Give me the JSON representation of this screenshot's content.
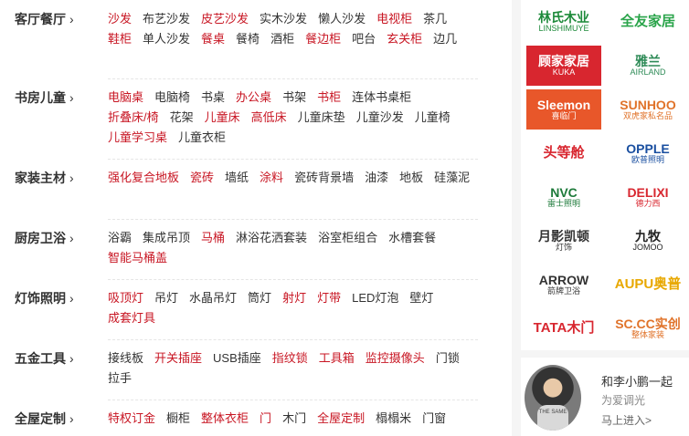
{
  "categories": [
    {
      "title": "客厅餐厅",
      "arrow": "›",
      "links": [
        {
          "text": "沙发",
          "hot": true
        },
        {
          "text": "布艺沙发",
          "hot": false
        },
        {
          "text": "皮艺沙发",
          "hot": true
        },
        {
          "text": "实木沙发",
          "hot": false
        },
        {
          "text": "懒人沙发",
          "hot": false
        },
        {
          "text": "电视柜",
          "hot": true
        },
        {
          "text": "茶几",
          "hot": false
        },
        {
          "text": "鞋柜",
          "hot": true
        },
        {
          "text": "单人沙发",
          "hot": false
        },
        {
          "text": "餐桌",
          "hot": true
        },
        {
          "text": "餐椅",
          "hot": false
        },
        {
          "text": "酒柜",
          "hot": false
        },
        {
          "text": "餐边柜",
          "hot": true
        },
        {
          "text": "吧台",
          "hot": false
        },
        {
          "text": "玄关柜",
          "hot": true
        },
        {
          "text": "边几",
          "hot": false
        }
      ]
    },
    {
      "title": "书房儿童",
      "arrow": "›",
      "links": [
        {
          "text": "电脑桌",
          "hot": true
        },
        {
          "text": "电脑椅",
          "hot": false
        },
        {
          "text": "书桌",
          "hot": false
        },
        {
          "text": "办公桌",
          "hot": true
        },
        {
          "text": "书架",
          "hot": false
        },
        {
          "text": "书柜",
          "hot": true
        },
        {
          "text": "连体书桌柜",
          "hot": false
        },
        {
          "text": "折叠床/椅",
          "hot": true
        },
        {
          "text": "花架",
          "hot": false
        },
        {
          "text": "儿童床",
          "hot": true
        },
        {
          "text": "高低床",
          "hot": true
        },
        {
          "text": "儿童床垫",
          "hot": false
        },
        {
          "text": "儿童沙发",
          "hot": false
        },
        {
          "text": "儿童椅",
          "hot": false
        },
        {
          "text": "儿童学习桌",
          "hot": true
        },
        {
          "text": "儿童衣柜",
          "hot": false
        }
      ]
    },
    {
      "title": "家装主材",
      "arrow": "›",
      "links": [
        {
          "text": "强化复合地板",
          "hot": true
        },
        {
          "text": "瓷砖",
          "hot": true
        },
        {
          "text": "墙纸",
          "hot": false
        },
        {
          "text": "涂料",
          "hot": true
        },
        {
          "text": "瓷砖背景墙",
          "hot": false
        },
        {
          "text": "油漆",
          "hot": false
        },
        {
          "text": "地板",
          "hot": false
        },
        {
          "text": "硅藻泥",
          "hot": false
        }
      ]
    },
    {
      "title": "厨房卫浴",
      "arrow": "›",
      "links": [
        {
          "text": "浴霸",
          "hot": false
        },
        {
          "text": "集成吊顶",
          "hot": false
        },
        {
          "text": "马桶",
          "hot": true
        },
        {
          "text": "淋浴花洒套装",
          "hot": false
        },
        {
          "text": "浴室柜组合",
          "hot": false
        },
        {
          "text": "水槽套餐",
          "hot": false
        },
        {
          "text": "智能马桶盖",
          "hot": true
        }
      ]
    },
    {
      "title": "灯饰照明",
      "arrow": "›",
      "links": [
        {
          "text": "吸顶灯",
          "hot": true
        },
        {
          "text": "吊灯",
          "hot": false
        },
        {
          "text": "水晶吊灯",
          "hot": false
        },
        {
          "text": "筒灯",
          "hot": false
        },
        {
          "text": "射灯",
          "hot": true
        },
        {
          "text": "灯带",
          "hot": true
        },
        {
          "text": "LED灯泡",
          "hot": false
        },
        {
          "text": "壁灯",
          "hot": false
        },
        {
          "text": "成套灯具",
          "hot": true
        }
      ]
    },
    {
      "title": "五金工具",
      "arrow": "›",
      "links": [
        {
          "text": "接线板",
          "hot": false
        },
        {
          "text": "开关插座",
          "hot": true
        },
        {
          "text": "USB插座",
          "hot": false
        },
        {
          "text": "指纹锁",
          "hot": true
        },
        {
          "text": "工具箱",
          "hot": true
        },
        {
          "text": "监控摄像头",
          "hot": true
        },
        {
          "text": "门锁",
          "hot": false
        },
        {
          "text": "拉手",
          "hot": false
        }
      ]
    },
    {
      "title": "全屋定制",
      "arrow": "›",
      "links": [
        {
          "text": "特权订金",
          "hot": true
        },
        {
          "text": "橱柜",
          "hot": false
        },
        {
          "text": "整体衣柜",
          "hot": true
        },
        {
          "text": "门",
          "hot": true
        },
        {
          "text": "木门",
          "hot": false
        },
        {
          "text": "全屋定制",
          "hot": true
        },
        {
          "text": "榻榻米",
          "hot": false
        },
        {
          "text": "门窗",
          "hot": false
        }
      ]
    }
  ],
  "brands": [
    {
      "name": "linshimuye-logo",
      "line1": "林氏木业",
      "line2": "LINSHIMUYE",
      "color": "#1d8a3a",
      "bg": "#ffffff"
    },
    {
      "name": "quanyou-logo",
      "line1": "全友家居",
      "line2": "",
      "color": "#2aa44a",
      "bg": "#ffffff"
    },
    {
      "name": "kuka-logo",
      "line1": "顾家家居",
      "line2": "KUKA",
      "color": "#ffffff",
      "bg": "#d8262f"
    },
    {
      "name": "airland-logo",
      "line1": "雅兰",
      "line2": "AIRLAND",
      "color": "#2e8b57",
      "bg": "#ffffff"
    },
    {
      "name": "sleemon-logo",
      "line1": "Sleemon",
      "line2": "喜临门",
      "color": "#ffffff",
      "bg": "#e8572a"
    },
    {
      "name": "sunhoo-logo",
      "line1": "SUNHOO",
      "line2": "双虎家私名品",
      "color": "#e0732a",
      "bg": "#ffffff"
    },
    {
      "name": "toudengcang-logo",
      "line1": "头等舱",
      "line2": "",
      "color": "#d8262f",
      "bg": "#ffffff"
    },
    {
      "name": "opple-logo",
      "line1": "OPPLE",
      "line2": "欧普照明",
      "color": "#1a4fa0",
      "bg": "#ffffff"
    },
    {
      "name": "nvc-logo",
      "line1": "NVC",
      "line2": "雷士照明",
      "color": "#1d7a3a",
      "bg": "#ffffff"
    },
    {
      "name": "delixi-logo",
      "line1": "DELIXI",
      "line2": "德力西",
      "color": "#d8262f",
      "bg": "#ffffff"
    },
    {
      "name": "yueying-logo",
      "line1": "月影凯顿",
      "line2": "灯饰",
      "color": "#333333",
      "bg": "#ffffff"
    },
    {
      "name": "jomoo-logo",
      "line1": "九牧",
      "line2": "JOMOO",
      "color": "#222222",
      "bg": "#ffffff"
    },
    {
      "name": "arrow-logo",
      "line1": "ARROW",
      "line2": "箭牌卫浴",
      "color": "#333333",
      "bg": "#ffffff"
    },
    {
      "name": "aupu-logo",
      "line1": "AUPU奥普",
      "line2": "",
      "color": "#e8a800",
      "bg": "#ffffff"
    },
    {
      "name": "tata-logo",
      "line1": "TATA木门",
      "line2": "",
      "color": "#d8262f",
      "bg": "#ffffff"
    },
    {
      "name": "sccc-logo",
      "line1": "SC.CC实创",
      "line2": "整体家装",
      "color": "#e0732a",
      "bg": "#ffffff"
    }
  ],
  "promo": {
    "title": "和李小鹏一起",
    "subtitle": "为爱调光",
    "link": "马上进入>",
    "shirt_text": "THE SAME"
  }
}
